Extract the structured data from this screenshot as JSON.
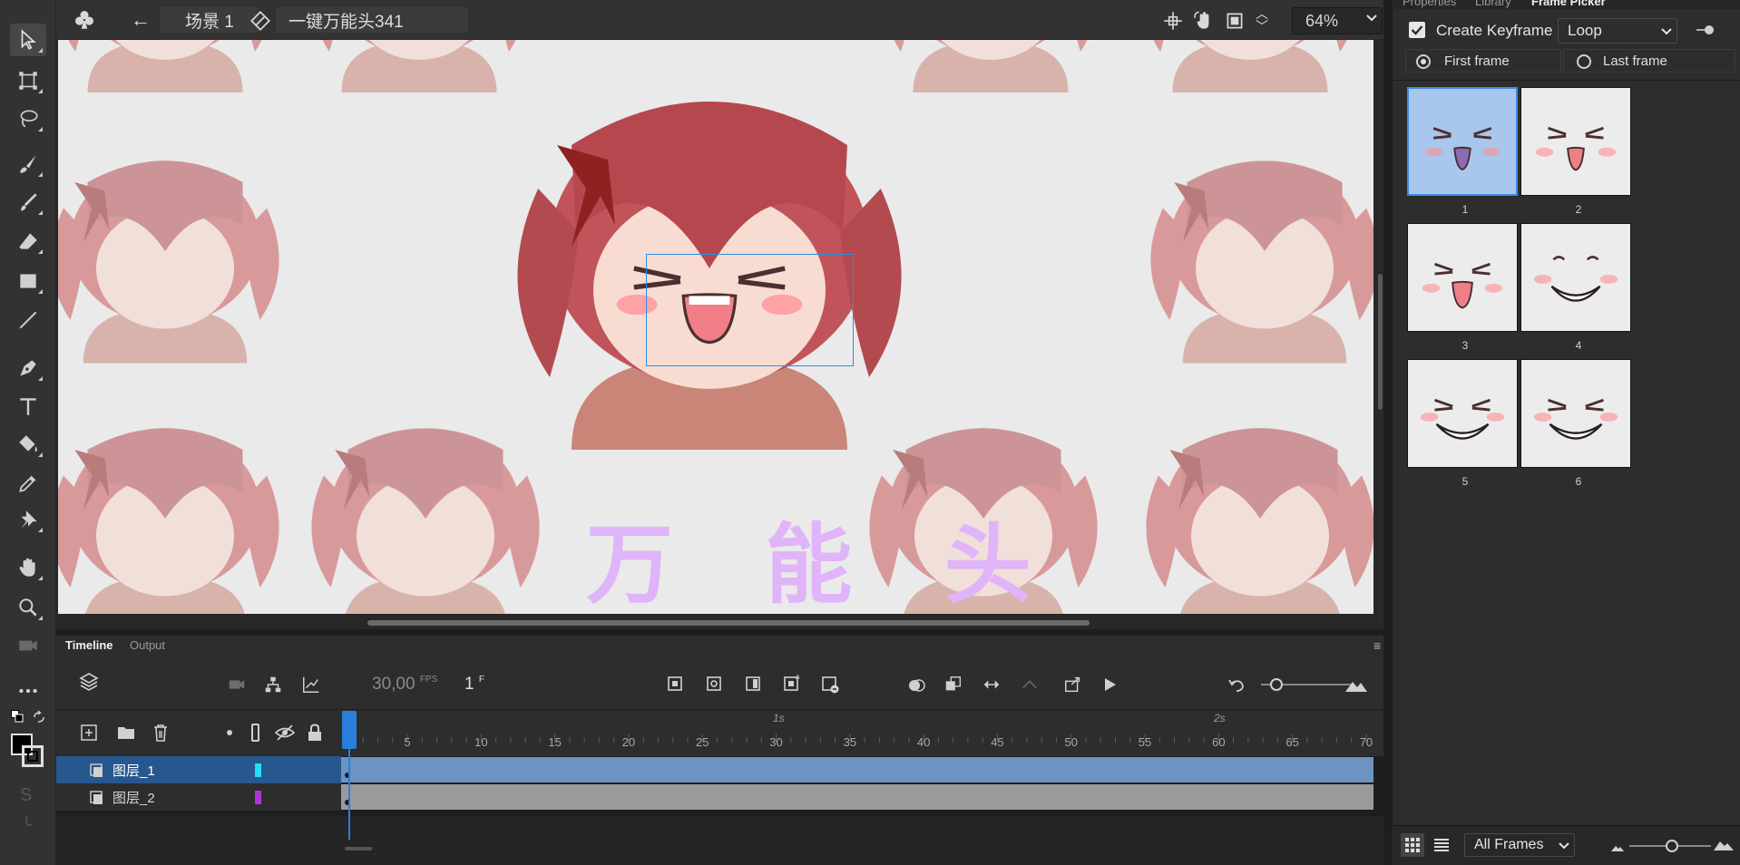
{
  "topbar": {
    "back_label": "←",
    "scene_label": "场景 1",
    "symbol_label": "一键万能头341",
    "zoom_value": "64%"
  },
  "stage": {
    "big_text": "万 能 头"
  },
  "timeline": {
    "tab_timeline": "Timeline",
    "tab_output": "Output",
    "fps_value": "30,00",
    "fps_unit": "FPS",
    "frame_value": "1",
    "frame_unit": "F",
    "ticks": [
      "5",
      "10",
      "15",
      "20",
      "25",
      "30",
      "35",
      "40",
      "45",
      "50",
      "55",
      "60",
      "65",
      "70"
    ],
    "sec_labels": [
      "1s",
      "2s"
    ],
    "layers": [
      {
        "name": "图层_1",
        "color": "#21e0ff",
        "selected": true
      },
      {
        "name": "图层_2",
        "color": "#b232d6",
        "selected": false
      }
    ]
  },
  "right_panel": {
    "tabs": [
      "Properties",
      "Library",
      "Frame Picker"
    ],
    "create_keyframe_label": "Create Keyframe",
    "create_keyframe_checked": true,
    "loop_select": "Loop",
    "first_frame_label": "First frame",
    "last_frame_label": "Last frame",
    "selected_radio": "first",
    "frame_labels": [
      "1",
      "2",
      "3",
      "4",
      "5",
      "6"
    ],
    "frames_filter": "All Frames"
  },
  "colors": {
    "accent": "#2a7fdc",
    "stage_bg": "#eaeaea",
    "panel_bg": "#2d2d2d",
    "text_purple": "#e0b4f8"
  }
}
